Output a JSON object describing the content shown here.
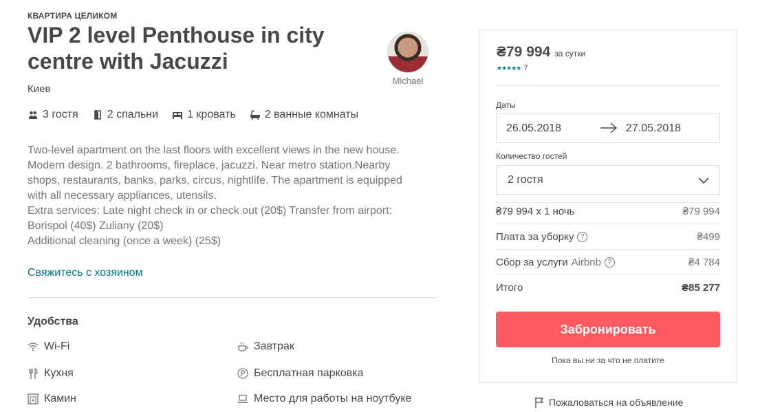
{
  "listing": {
    "kicker": "КВАРТИРА ЦЕЛИКОМ",
    "title": "VIP 2 level Penthouse in city centre with Jacuzzi",
    "city": "Киев",
    "host_name": "Michael",
    "stats": [
      {
        "icon": "guests-icon",
        "label": "3 гостя"
      },
      {
        "icon": "door-icon",
        "label": "2 спальни"
      },
      {
        "icon": "bed-icon",
        "label": "1 кровать"
      },
      {
        "icon": "bathtub-icon",
        "label": "2 ванные комнаты"
      }
    ],
    "description": [
      "Two-level apartment on the last floors with excellent views in the new house.",
      "Modern design. 2 bathrooms, fireplace, jacuzzi. Near metro station.Nearby",
      "shops, restaurants, banks, parks, circus, nightlife. The apartment is equipped",
      "with all necessary appliances, utensils.",
      "Extra services: Late night check in or check out (20$) Transfer from airport:",
      "Borispol (40$) Zuliany (20$)",
      "Additional cleaning (once a week) (25$)"
    ],
    "contact_link": "Свяжитесь с хозяином"
  },
  "amenities": {
    "title": "Удобства",
    "items": [
      {
        "icon": "wifi-icon",
        "label": "Wi-Fi"
      },
      {
        "icon": "coffee-icon",
        "label": "Завтрак"
      },
      {
        "icon": "kitchen-icon",
        "label": "Кухня"
      },
      {
        "icon": "parking-icon",
        "label": "Бесплатная парковка"
      },
      {
        "icon": "fireplace-icon",
        "label": "Камин"
      },
      {
        "icon": "laptop-icon",
        "label": "Место для работы на ноутбуке"
      }
    ]
  },
  "booking": {
    "price": "₴79 994",
    "price_unit": "за сутки",
    "stars": "★★★★★",
    "reviews_count": "7",
    "dates_label": "Даты",
    "check_in": "26.05.2018",
    "check_out": "27.05.2018",
    "guests_label": "Количество гостей",
    "guests_value": "2 гостя",
    "lines": [
      {
        "label": "₴79 994 x 1 ночь",
        "value": "₴79 994"
      },
      {
        "label": "Плата за уборку",
        "value": "₴499"
      },
      {
        "label": "Сбор за услуги",
        "label_suffix": "Airbnb",
        "value": "₴4 784"
      },
      {
        "label": "Итого",
        "value": "₴85 277"
      }
    ],
    "book_button": "Забронировать",
    "note": "Пока вы ни за что не платите",
    "report_link": "Пожаловаться на объявление",
    "accent_color": "#ff5a5f",
    "link_color": "#007a87"
  }
}
